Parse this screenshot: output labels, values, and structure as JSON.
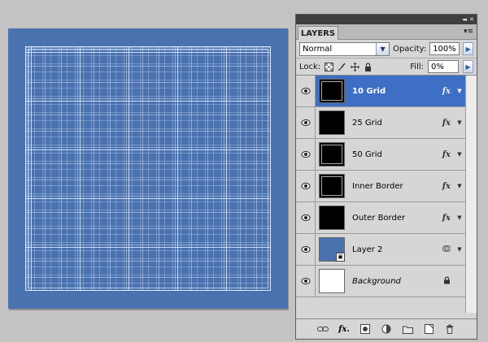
{
  "panel": {
    "tab_label": "LAYERS",
    "collapse_glyph": "◂◂",
    "close_glyph": "✕",
    "menu_glyph": "▾≡",
    "blend_mode": "Normal",
    "opacity_label": "Opacity:",
    "opacity_value": "100%",
    "lock_label": "Lock:",
    "fill_label": "Fill:",
    "fill_value": "0%"
  },
  "layers": [
    {
      "name": "10 Grid",
      "thumb": "black",
      "fx": "fx",
      "selected": true
    },
    {
      "name": "25 Grid",
      "thumb": "black",
      "fx": "fx"
    },
    {
      "name": "50 Grid",
      "thumb": "black",
      "fx": "fx"
    },
    {
      "name": "Inner Border",
      "thumb": "black",
      "fx": "fx"
    },
    {
      "name": "Outer Border",
      "thumb": "black",
      "fx": "fx"
    },
    {
      "name": "Layer 2",
      "thumb": "blue",
      "fx": ""
    },
    {
      "name": "Background",
      "thumb": "white",
      "fx": ""
    }
  ],
  "footer_icons": [
    "link-icon",
    "fx-menu-icon",
    "mask-icon",
    "adjustment-icon",
    "folder-icon",
    "new-layer-icon",
    "trash-icon"
  ],
  "colors": {
    "canvas": "#4a72ae",
    "selection": "#3d6fc4",
    "workspace": "#c3c3c3"
  }
}
